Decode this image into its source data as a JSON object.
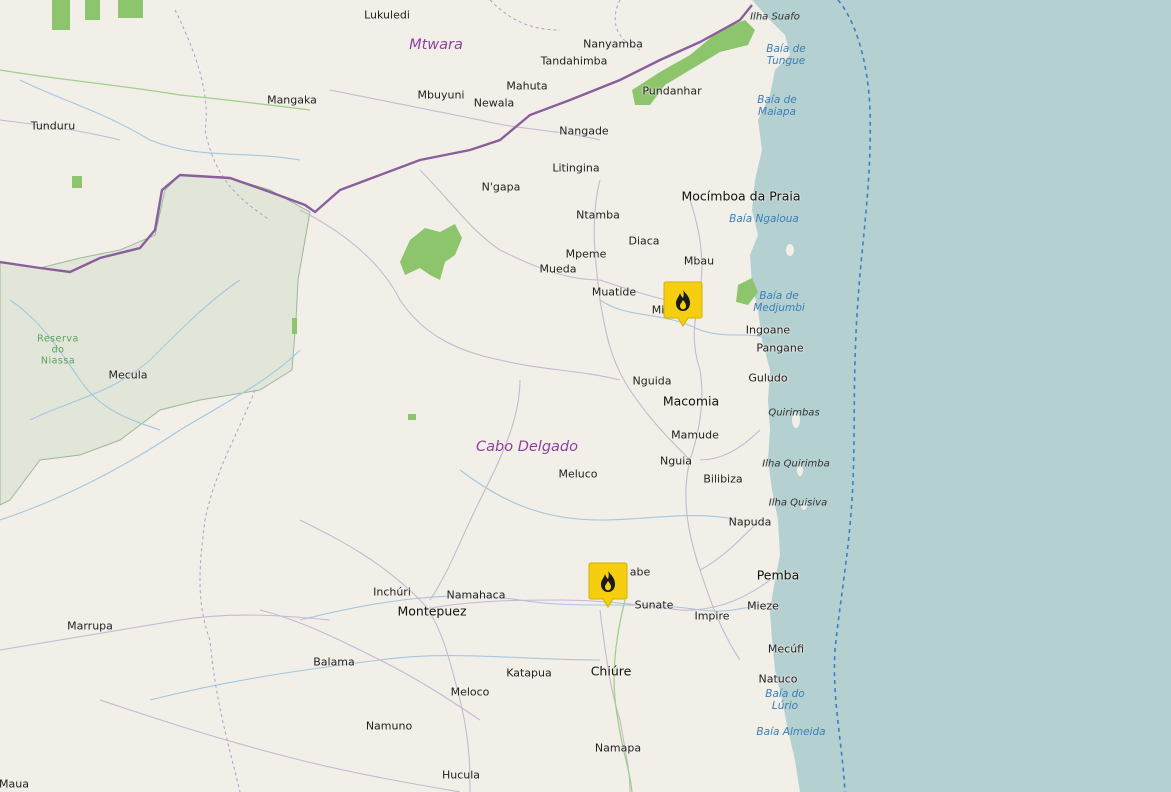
{
  "map": {
    "regions": [
      {
        "id": "mtwara",
        "label": "Mtwara"
      },
      {
        "id": "cabo-delgado",
        "label": "Cabo Delgado"
      }
    ],
    "reserve": {
      "label": "Reserva\ndo\nNiassa"
    },
    "towns": [
      {
        "id": "lukuledi",
        "label": "Lukuledi"
      },
      {
        "id": "nanyamba",
        "label": "Nanyamba"
      },
      {
        "id": "tandahimba",
        "label": "Tandahimba"
      },
      {
        "id": "mangaka",
        "label": "Mangaka"
      },
      {
        "id": "mbuyuni",
        "label": "Mbuyuni"
      },
      {
        "id": "mahuta",
        "label": "Mahuta"
      },
      {
        "id": "newala",
        "label": "Newala"
      },
      {
        "id": "pundanhar",
        "label": "Pundanhar"
      },
      {
        "id": "tunduru",
        "label": "Tunduru"
      },
      {
        "id": "nangade",
        "label": "Nangade"
      },
      {
        "id": "litingina",
        "label": "Litingina"
      },
      {
        "id": "ngapa",
        "label": "N'gapa"
      },
      {
        "id": "mocimboa",
        "label": "Mocímboa da Praia"
      },
      {
        "id": "ntamba",
        "label": "Ntamba"
      },
      {
        "id": "diaca",
        "label": "Diaca"
      },
      {
        "id": "mpeme",
        "label": "Mpeme"
      },
      {
        "id": "mbau",
        "label": "Mbau"
      },
      {
        "id": "mueda",
        "label": "Mueda"
      },
      {
        "id": "muatide",
        "label": "Muatide"
      },
      {
        "id": "mi",
        "label": "Mi"
      },
      {
        "id": "ingoane",
        "label": "Ingoane"
      },
      {
        "id": "pangane",
        "label": "Pangane"
      },
      {
        "id": "nguida",
        "label": "Nguida"
      },
      {
        "id": "guludo",
        "label": "Guludo"
      },
      {
        "id": "mecula",
        "label": "Mecula"
      },
      {
        "id": "macomia",
        "label": "Macomia"
      },
      {
        "id": "mamude",
        "label": "Mamude"
      },
      {
        "id": "nguia",
        "label": "Nguia"
      },
      {
        "id": "meluco",
        "label": "Meluco"
      },
      {
        "id": "bilibiza",
        "label": "Bilibiza"
      },
      {
        "id": "napuda",
        "label": "Napuda"
      },
      {
        "id": "pemba",
        "label": "Pemba"
      },
      {
        "id": "abe",
        "label": "abe"
      },
      {
        "id": "inchuri",
        "label": "Inchúri"
      },
      {
        "id": "namahaca",
        "label": "Namahaca"
      },
      {
        "id": "montepuez",
        "label": "Montepuez"
      },
      {
        "id": "sunate",
        "label": "Sunate"
      },
      {
        "id": "mieze",
        "label": "Mieze"
      },
      {
        "id": "impire",
        "label": "Impire"
      },
      {
        "id": "marrupa",
        "label": "Marrupa"
      },
      {
        "id": "mecufi",
        "label": "Mecúfi"
      },
      {
        "id": "balama",
        "label": "Balama"
      },
      {
        "id": "chiure",
        "label": "Chiúre"
      },
      {
        "id": "katapua",
        "label": "Katapua"
      },
      {
        "id": "natuco",
        "label": "Natuco"
      },
      {
        "id": "meloco",
        "label": "Meloco"
      },
      {
        "id": "namuno",
        "label": "Namuno"
      },
      {
        "id": "namapa",
        "label": "Namapa"
      },
      {
        "id": "maua",
        "label": "Maua"
      },
      {
        "id": "hucula",
        "label": "Hucula"
      }
    ],
    "water_labels": [
      {
        "id": "baia-de-tungue",
        "label": "Baía de\nTungue"
      },
      {
        "id": "baia-de-maiapa",
        "label": "Baía de\nMaiapa"
      },
      {
        "id": "baia-ngaloua",
        "label": "Baía Ngaloua"
      },
      {
        "id": "baia-de-medjumbi",
        "label": "Baía de\nMedjumbi"
      },
      {
        "id": "baia-do-lurio",
        "label": "Baía do\nLúrio"
      },
      {
        "id": "baia-almeida",
        "label": "Baía Almeida"
      }
    ],
    "islands": [
      {
        "id": "ilha-suafo",
        "label": "Ilha Suafo"
      },
      {
        "id": "quirimbas",
        "label": "Quirimbas"
      },
      {
        "id": "ilha-quirimba",
        "label": "Ilha Quirimba"
      },
      {
        "id": "ilha-quisiva",
        "label": "Ilha Quisiva"
      }
    ],
    "markers": [
      {
        "id": "fire-1",
        "icon": "fire-icon",
        "color": "#f5cf0f"
      },
      {
        "id": "fire-2",
        "icon": "fire-icon",
        "color": "#f5cf0f"
      }
    ],
    "colors": {
      "land": "#f2efe9",
      "sea": "#b5d0d0",
      "reserve": "#e1e6d9",
      "forest": "#8dc56c",
      "border": "#8a5e9b",
      "marker": "#f5cf0f"
    }
  }
}
